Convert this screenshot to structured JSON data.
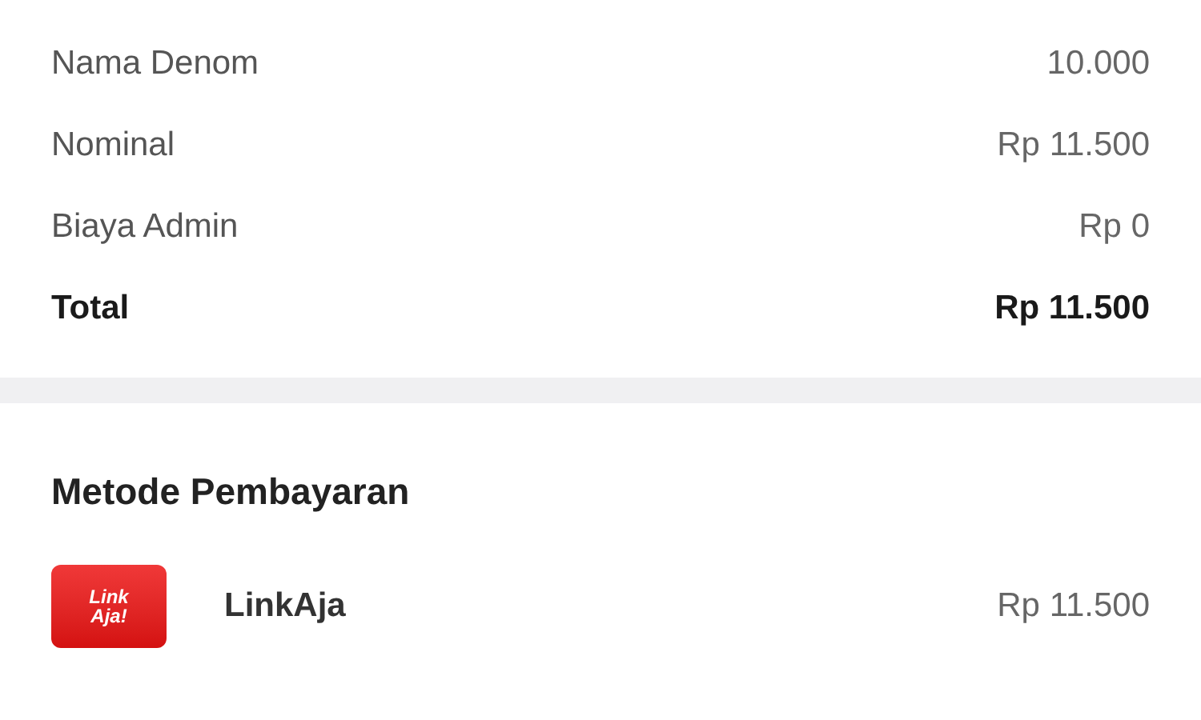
{
  "details": [
    {
      "label": "Nama Denom",
      "value": "10.000",
      "bold": false
    },
    {
      "label": "Nominal",
      "value": "Rp 11.500",
      "bold": false
    },
    {
      "label": "Biaya Admin",
      "value": "Rp 0",
      "bold": false
    },
    {
      "label": "Total",
      "value": "Rp 11.500",
      "bold": true
    }
  ],
  "payment": {
    "title": "Metode Pembayaran",
    "method": {
      "logo_lines": [
        "Link",
        "Aja!"
      ],
      "name": "LinkAja",
      "amount": "Rp 11.500"
    }
  }
}
